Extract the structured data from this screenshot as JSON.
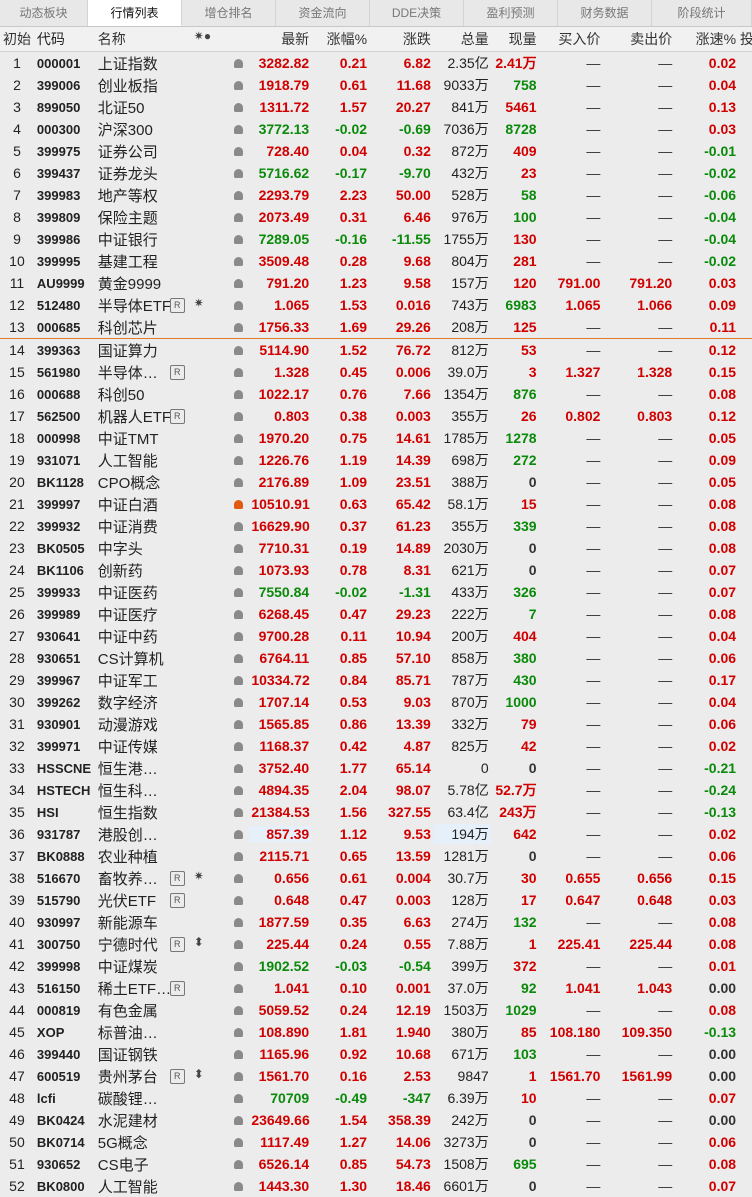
{
  "tabs": [
    "动态板块",
    "行情列表",
    "增仓排名",
    "资金流向",
    "DDE决策",
    "盈利预测",
    "财务数据",
    "阶段统计"
  ],
  "active_tab": 1,
  "header": {
    "idx": "初始",
    "code": "代码",
    "name": "名称",
    "name_sym": "✷●",
    "last": "最新",
    "pct": "涨幅%",
    "chg": "涨跌",
    "vol": "总量",
    "cur": "现量",
    "bid": "买入价",
    "ask": "卖出价",
    "spd": "涨速%",
    "extra": "投"
  },
  "rows": [
    {
      "i": "1",
      "code": "000001",
      "name": "上证指数",
      "last": "3282.82",
      "pct": "0.21",
      "chg": "6.82",
      "vol": "2.35亿",
      "cur": "2.41万",
      "bid": "—",
      "ask": "—",
      "spd": "0.02",
      "t": "u",
      "cu": "u",
      "su": "u"
    },
    {
      "i": "2",
      "code": "399006",
      "name": "创业板指",
      "last": "1918.79",
      "pct": "0.61",
      "chg": "11.68",
      "vol": "9033万",
      "cur": "758",
      "bid": "—",
      "ask": "—",
      "spd": "0.04",
      "t": "u",
      "cu": "d",
      "su": "u"
    },
    {
      "i": "3",
      "code": "899050",
      "name": "北证50",
      "last": "1311.72",
      "pct": "1.57",
      "chg": "20.27",
      "vol": "841万",
      "cur": "5461",
      "bid": "—",
      "ask": "—",
      "spd": "0.13",
      "t": "u",
      "cu": "u",
      "su": "u"
    },
    {
      "i": "4",
      "code": "000300",
      "name": "沪深300",
      "last": "3772.13",
      "pct": "-0.02",
      "chg": "-0.69",
      "vol": "7036万",
      "cur": "8728",
      "bid": "—",
      "ask": "—",
      "spd": "0.03",
      "t": "d",
      "cu": "d",
      "su": "u"
    },
    {
      "i": "5",
      "code": "399975",
      "name": "证券公司",
      "last": "728.40",
      "pct": "0.04",
      "chg": "0.32",
      "vol": "872万",
      "cur": "409",
      "bid": "—",
      "ask": "—",
      "spd": "-0.01",
      "t": "u",
      "cu": "u",
      "su": "d"
    },
    {
      "i": "6",
      "code": "399437",
      "name": "证券龙头",
      "last": "5716.62",
      "pct": "-0.17",
      "chg": "-9.70",
      "vol": "432万",
      "cur": "23",
      "bid": "—",
      "ask": "—",
      "spd": "-0.02",
      "t": "d",
      "cu": "u",
      "su": "d"
    },
    {
      "i": "7",
      "code": "399983",
      "name": "地产等权",
      "last": "2293.79",
      "pct": "2.23",
      "chg": "50.00",
      "vol": "528万",
      "cur": "58",
      "bid": "—",
      "ask": "—",
      "spd": "-0.06",
      "t": "u",
      "cu": "d",
      "su": "d"
    },
    {
      "i": "8",
      "code": "399809",
      "name": "保险主题",
      "last": "2073.49",
      "pct": "0.31",
      "chg": "6.46",
      "vol": "976万",
      "cur": "100",
      "bid": "—",
      "ask": "—",
      "spd": "-0.04",
      "t": "u",
      "cu": "d",
      "su": "d"
    },
    {
      "i": "9",
      "code": "399986",
      "name": "中证银行",
      "last": "7289.05",
      "pct": "-0.16",
      "chg": "-11.55",
      "vol": "1755万",
      "cur": "130",
      "bid": "—",
      "ask": "—",
      "spd": "-0.04",
      "t": "d",
      "cu": "u",
      "su": "d"
    },
    {
      "i": "10",
      "code": "399995",
      "name": "基建工程",
      "last": "3509.48",
      "pct": "0.28",
      "chg": "9.68",
      "vol": "804万",
      "cur": "281",
      "bid": "—",
      "ask": "—",
      "spd": "-0.02",
      "t": "u",
      "cu": "u",
      "su": "d"
    },
    {
      "i": "11",
      "code": "AU9999",
      "name": "黄金9999",
      "last": "791.20",
      "pct": "1.23",
      "chg": "9.58",
      "vol": "157万",
      "cur": "120",
      "bid": "791.00",
      "ask": "791.20",
      "spd": "0.03",
      "t": "u",
      "cu": "u",
      "su": "u"
    },
    {
      "i": "12",
      "code": "512480",
      "name": "半导体ETF",
      "rb": "R",
      "sym": "✷",
      "last": "1.065",
      "pct": "1.53",
      "chg": "0.016",
      "vol": "743万",
      "cur": "6983",
      "bid": "1.065",
      "ask": "1.066",
      "spd": "0.09",
      "t": "u",
      "cu": "d",
      "su": "u"
    },
    {
      "i": "13",
      "code": "000685",
      "name": "科创芯片",
      "last": "1756.33",
      "pct": "1.69",
      "chg": "29.26",
      "vol": "208万",
      "cur": "125",
      "bid": "—",
      "ask": "—",
      "spd": "0.11",
      "t": "u",
      "cu": "u",
      "su": "u",
      "sep": true
    },
    {
      "i": "14",
      "code": "399363",
      "name": "国证算力",
      "last": "5114.90",
      "pct": "1.52",
      "chg": "76.72",
      "vol": "812万",
      "cur": "53",
      "bid": "—",
      "ask": "—",
      "spd": "0.12",
      "t": "u",
      "cu": "u",
      "su": "u"
    },
    {
      "i": "15",
      "code": "561980",
      "name": "半导体设备",
      "rb": "R",
      "last": "1.328",
      "pct": "0.45",
      "chg": "0.006",
      "vol": "39.0万",
      "cur": "3",
      "bid": "1.327",
      "ask": "1.328",
      "spd": "0.15",
      "t": "u",
      "cu": "u",
      "su": "u"
    },
    {
      "i": "16",
      "code": "000688",
      "name": "科创50",
      "last": "1022.17",
      "pct": "0.76",
      "chg": "7.66",
      "vol": "1354万",
      "cur": "876",
      "bid": "—",
      "ask": "—",
      "spd": "0.08",
      "t": "u",
      "cu": "d",
      "su": "u"
    },
    {
      "i": "17",
      "code": "562500",
      "name": "机器人ETF",
      "rb": "R",
      "last": "0.803",
      "pct": "0.38",
      "chg": "0.003",
      "vol": "355万",
      "cur": "26",
      "bid": "0.802",
      "ask": "0.803",
      "spd": "0.12",
      "t": "u",
      "cu": "u",
      "su": "u"
    },
    {
      "i": "18",
      "code": "000998",
      "name": "中证TMT",
      "last": "1970.20",
      "pct": "0.75",
      "chg": "14.61",
      "vol": "1785万",
      "cur": "1278",
      "bid": "—",
      "ask": "—",
      "spd": "0.05",
      "t": "u",
      "cu": "d",
      "su": "u"
    },
    {
      "i": "19",
      "code": "931071",
      "name": "人工智能",
      "last": "1226.76",
      "pct": "1.19",
      "chg": "14.39",
      "vol": "698万",
      "cur": "272",
      "bid": "—",
      "ask": "—",
      "spd": "0.09",
      "t": "u",
      "cu": "d",
      "su": "u"
    },
    {
      "i": "20",
      "code": "BK1128",
      "name": "CPO概念",
      "last": "2176.89",
      "pct": "1.09",
      "chg": "23.51",
      "vol": "388万",
      "cur": "0",
      "bid": "—",
      "ask": "—",
      "spd": "0.05",
      "t": "u",
      "cu": "f",
      "su": "u"
    },
    {
      "i": "21",
      "code": "399997",
      "name": "中证白酒",
      "bell": "on",
      "last": "10510.91",
      "pct": "0.63",
      "chg": "65.42",
      "vol": "58.1万",
      "cur": "15",
      "bid": "—",
      "ask": "—",
      "spd": "0.08",
      "t": "u",
      "cu": "u",
      "su": "u"
    },
    {
      "i": "22",
      "code": "399932",
      "name": "中证消费",
      "last": "16629.90",
      "pct": "0.37",
      "chg": "61.23",
      "vol": "355万",
      "cur": "339",
      "bid": "—",
      "ask": "—",
      "spd": "0.08",
      "t": "u",
      "cu": "d",
      "su": "u"
    },
    {
      "i": "23",
      "code": "BK0505",
      "name": "中字头",
      "last": "7710.31",
      "pct": "0.19",
      "chg": "14.89",
      "vol": "2030万",
      "cur": "0",
      "bid": "—",
      "ask": "—",
      "spd": "0.08",
      "t": "u",
      "cu": "f",
      "su": "u"
    },
    {
      "i": "24",
      "code": "BK1106",
      "name": "创新药",
      "last": "1073.93",
      "pct": "0.78",
      "chg": "8.31",
      "vol": "621万",
      "cur": "0",
      "bid": "—",
      "ask": "—",
      "spd": "0.07",
      "t": "u",
      "cu": "f",
      "su": "u"
    },
    {
      "i": "25",
      "code": "399933",
      "name": "中证医药",
      "last": "7550.84",
      "pct": "-0.02",
      "chg": "-1.31",
      "vol": "433万",
      "cur": "326",
      "bid": "—",
      "ask": "—",
      "spd": "0.07",
      "t": "d",
      "cu": "d",
      "su": "u"
    },
    {
      "i": "26",
      "code": "399989",
      "name": "中证医疗",
      "last": "6268.45",
      "pct": "0.47",
      "chg": "29.23",
      "vol": "222万",
      "cur": "7",
      "bid": "—",
      "ask": "—",
      "spd": "0.08",
      "t": "u",
      "cu": "d",
      "su": "u"
    },
    {
      "i": "27",
      "code": "930641",
      "name": "中证中药",
      "last": "9700.28",
      "pct": "0.11",
      "chg": "10.94",
      "vol": "200万",
      "cur": "404",
      "bid": "—",
      "ask": "—",
      "spd": "0.04",
      "t": "u",
      "cu": "u",
      "su": "u"
    },
    {
      "i": "28",
      "code": "930651",
      "name": "CS计算机",
      "last": "6764.11",
      "pct": "0.85",
      "chg": "57.10",
      "vol": "858万",
      "cur": "380",
      "bid": "—",
      "ask": "—",
      "spd": "0.06",
      "t": "u",
      "cu": "d",
      "su": "u"
    },
    {
      "i": "29",
      "code": "399967",
      "name": "中证军工",
      "last": "10334.72",
      "pct": "0.84",
      "chg": "85.71",
      "vol": "787万",
      "cur": "430",
      "bid": "—",
      "ask": "—",
      "spd": "0.17",
      "t": "u",
      "cu": "d",
      "su": "u"
    },
    {
      "i": "30",
      "code": "399262",
      "name": "数字经济",
      "last": "1707.14",
      "pct": "0.53",
      "chg": "9.03",
      "vol": "870万",
      "cur": "1000",
      "bid": "—",
      "ask": "—",
      "spd": "0.04",
      "t": "u",
      "cu": "d",
      "su": "u"
    },
    {
      "i": "31",
      "code": "930901",
      "name": "动漫游戏",
      "last": "1565.85",
      "pct": "0.86",
      "chg": "13.39",
      "vol": "332万",
      "cur": "79",
      "bid": "—",
      "ask": "—",
      "spd": "0.06",
      "t": "u",
      "cu": "u",
      "su": "u"
    },
    {
      "i": "32",
      "code": "399971",
      "name": "中证传媒",
      "last": "1168.37",
      "pct": "0.42",
      "chg": "4.87",
      "vol": "825万",
      "cur": "42",
      "bid": "—",
      "ask": "—",
      "spd": "0.02",
      "t": "u",
      "cu": "u",
      "su": "u"
    },
    {
      "i": "33",
      "code": "HSSCNE",
      "name": "恒生港股通新经济",
      "last": "3752.40",
      "pct": "1.77",
      "chg": "65.14",
      "vol": "0",
      "cur": "0",
      "bid": "—",
      "ask": "—",
      "spd": "-0.21",
      "t": "u",
      "cu": "f",
      "su": "d"
    },
    {
      "i": "34",
      "code": "HSTECH",
      "name": "恒生科技指数",
      "last": "4894.35",
      "pct": "2.04",
      "chg": "98.07",
      "vol": "5.78亿",
      "cur": "52.7万",
      "bid": "—",
      "ask": "—",
      "spd": "-0.24",
      "t": "u",
      "cu": "u",
      "su": "d"
    },
    {
      "i": "35",
      "code": "HSI",
      "name": "恒生指数",
      "last": "21384.53",
      "pct": "1.56",
      "chg": "327.55",
      "vol": "63.4亿",
      "cur": "243万",
      "bid": "—",
      "ask": "—",
      "spd": "-0.13",
      "t": "u",
      "cu": "u",
      "su": "d"
    },
    {
      "i": "36",
      "code": "931787",
      "name": "港股创新药",
      "last": "857.39",
      "pct": "1.12",
      "chg": "9.53",
      "vol": "194万",
      "cur": "642",
      "bid": "—",
      "ask": "—",
      "spd": "0.02",
      "t": "u",
      "cu": "u",
      "su": "u",
      "hl": true
    },
    {
      "i": "37",
      "code": "BK0888",
      "name": "农业种植",
      "last": "2115.71",
      "pct": "0.65",
      "chg": "13.59",
      "vol": "1281万",
      "cur": "0",
      "bid": "—",
      "ask": "—",
      "spd": "0.06",
      "t": "u",
      "cu": "f",
      "su": "u"
    },
    {
      "i": "38",
      "code": "516670",
      "name": "畜牧养殖ETF",
      "rb": "R",
      "sym": "✷",
      "last": "0.656",
      "pct": "0.61",
      "chg": "0.004",
      "vol": "30.7万",
      "cur": "30",
      "bid": "0.655",
      "ask": "0.656",
      "spd": "0.15",
      "t": "u",
      "cu": "u",
      "su": "u"
    },
    {
      "i": "39",
      "code": "515790",
      "name": "光伏ETF",
      "rb": "R",
      "last": "0.648",
      "pct": "0.47",
      "chg": "0.003",
      "vol": "128万",
      "cur": "17",
      "bid": "0.647",
      "ask": "0.648",
      "spd": "0.03",
      "t": "u",
      "cu": "u",
      "su": "u"
    },
    {
      "i": "40",
      "code": "930997",
      "name": "新能源车",
      "last": "1877.59",
      "pct": "0.35",
      "chg": "6.63",
      "vol": "274万",
      "cur": "132",
      "bid": "—",
      "ask": "—",
      "spd": "0.08",
      "t": "u",
      "cu": "d",
      "su": "u"
    },
    {
      "i": "41",
      "code": "300750",
      "name": "宁德时代",
      "rb": "R",
      "sym": "⬍",
      "last": "225.44",
      "pct": "0.24",
      "chg": "0.55",
      "vol": "7.88万",
      "cur": "1",
      "bid": "225.41",
      "ask": "225.44",
      "spd": "0.08",
      "t": "u",
      "cu": "u",
      "su": "u"
    },
    {
      "i": "42",
      "code": "399998",
      "name": "中证煤炭",
      "last": "1902.52",
      "pct": "-0.03",
      "chg": "-0.54",
      "vol": "399万",
      "cur": "372",
      "bid": "—",
      "ask": "—",
      "spd": "0.01",
      "t": "d",
      "cu": "u",
      "su": "u"
    },
    {
      "i": "43",
      "code": "516150",
      "name": "稀土ETF嘉实",
      "rb": "R",
      "last": "1.041",
      "pct": "0.10",
      "chg": "0.001",
      "vol": "37.0万",
      "cur": "92",
      "bid": "1.041",
      "ask": "1.043",
      "spd": "0.00",
      "t": "u",
      "cu": "d",
      "su": "f"
    },
    {
      "i": "44",
      "code": "000819",
      "name": "有色金属",
      "last": "5059.52",
      "pct": "0.24",
      "chg": "12.19",
      "vol": "1503万",
      "cur": "1029",
      "bid": "—",
      "ask": "—",
      "spd": "0.08",
      "t": "u",
      "cu": "d",
      "su": "u"
    },
    {
      "i": "45",
      "code": "XOP",
      "name": "标普油气开采指数ETF",
      "last": "108.890",
      "pct": "1.81",
      "chg": "1.940",
      "vol": "380万",
      "cur": "85",
      "bid": "108.180",
      "ask": "109.350",
      "spd": "-0.13",
      "t": "u",
      "cu": "u",
      "su": "d"
    },
    {
      "i": "46",
      "code": "399440",
      "name": "国证钢铁",
      "last": "1165.96",
      "pct": "0.92",
      "chg": "10.68",
      "vol": "671万",
      "cur": "103",
      "bid": "—",
      "ask": "—",
      "spd": "0.00",
      "t": "u",
      "cu": "d",
      "su": "f"
    },
    {
      "i": "47",
      "code": "600519",
      "name": "贵州茅台",
      "rb": "R",
      "sym": "⬍",
      "last": "1561.70",
      "pct": "0.16",
      "chg": "2.53",
      "vol": "9847",
      "cur": "1",
      "bid": "1561.70",
      "ask": "1561.99",
      "spd": "0.00",
      "t": "u",
      "cu": "u",
      "su": "f"
    },
    {
      "i": "48",
      "code": "lcfi",
      "name": "碳酸锂加权",
      "last": "70709",
      "pct": "-0.49",
      "chg": "-347",
      "vol": "6.39万",
      "cur": "10",
      "bid": "—",
      "ask": "—",
      "spd": "0.07",
      "t": "d",
      "cu": "u",
      "su": "u"
    },
    {
      "i": "49",
      "code": "BK0424",
      "name": "水泥建材",
      "last": "23649.66",
      "pct": "1.54",
      "chg": "358.39",
      "vol": "242万",
      "cur": "0",
      "bid": "—",
      "ask": "—",
      "spd": "0.00",
      "t": "u",
      "cu": "f",
      "su": "f"
    },
    {
      "i": "50",
      "code": "BK0714",
      "name": "5G概念",
      "last": "1117.49",
      "pct": "1.27",
      "chg": "14.06",
      "vol": "3273万",
      "cur": "0",
      "bid": "—",
      "ask": "—",
      "spd": "0.06",
      "t": "u",
      "cu": "f",
      "su": "u"
    },
    {
      "i": "51",
      "code": "930652",
      "name": "CS电子",
      "last": "6526.14",
      "pct": "0.85",
      "chg": "54.73",
      "vol": "1508万",
      "cur": "695",
      "bid": "—",
      "ask": "—",
      "spd": "0.08",
      "t": "u",
      "cu": "d",
      "su": "u"
    },
    {
      "i": "52",
      "code": "BK0800",
      "name": "人工智能",
      "last": "1443.30",
      "pct": "1.30",
      "chg": "18.46",
      "vol": "6601万",
      "cur": "0",
      "bid": "—",
      "ask": "—",
      "spd": "0.07",
      "t": "u",
      "cu": "f",
      "su": "u"
    }
  ]
}
